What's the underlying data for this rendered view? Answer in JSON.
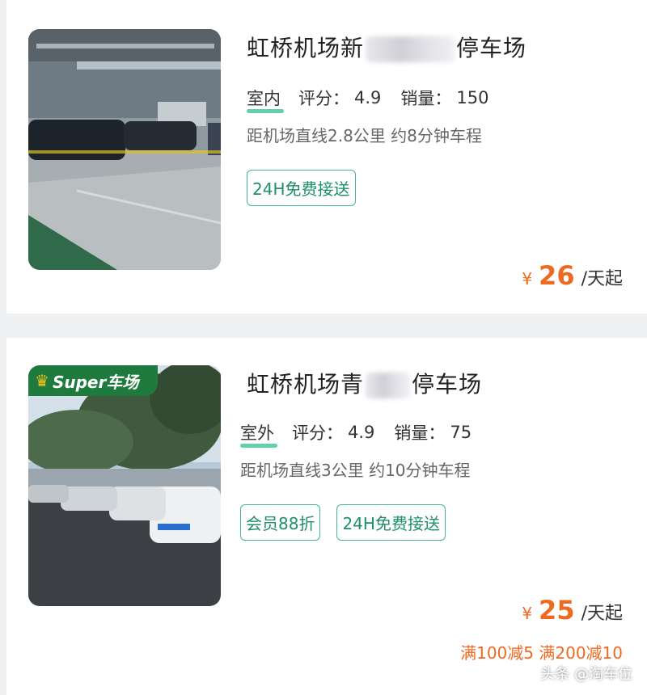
{
  "listings": [
    {
      "title_prefix": "虹桥机场新",
      "title_suffix": "停车场",
      "env": "室内",
      "rating_label": "评分：",
      "rating": "4.9",
      "sales_label": "销量：",
      "sales": "150",
      "distance": "距机场直线2.8公里 约8分钟车程",
      "tags": [
        "24H免费接送"
      ],
      "price_currency": "¥",
      "price": "26",
      "price_unit": "/天起"
    },
    {
      "badge_label": "Super车场",
      "title_prefix": "虹桥机场青",
      "title_suffix": "停车场",
      "env": "室外",
      "rating_label": "评分：",
      "rating": "4.9",
      "sales_label": "销量：",
      "sales": "75",
      "distance": "距机场直线3公里 约10分钟车程",
      "tags": [
        "会员88折",
        "24H免费接送"
      ],
      "price_currency": "¥",
      "price": "25",
      "price_unit": "/天起",
      "promo": "满100减5 满200减10"
    }
  ],
  "watermark": "头条 @淘车位",
  "colors": {
    "price_orange": "#ee6a21",
    "tag_green": "#1e8f6a",
    "badge_green": "#1f7a3d"
  }
}
